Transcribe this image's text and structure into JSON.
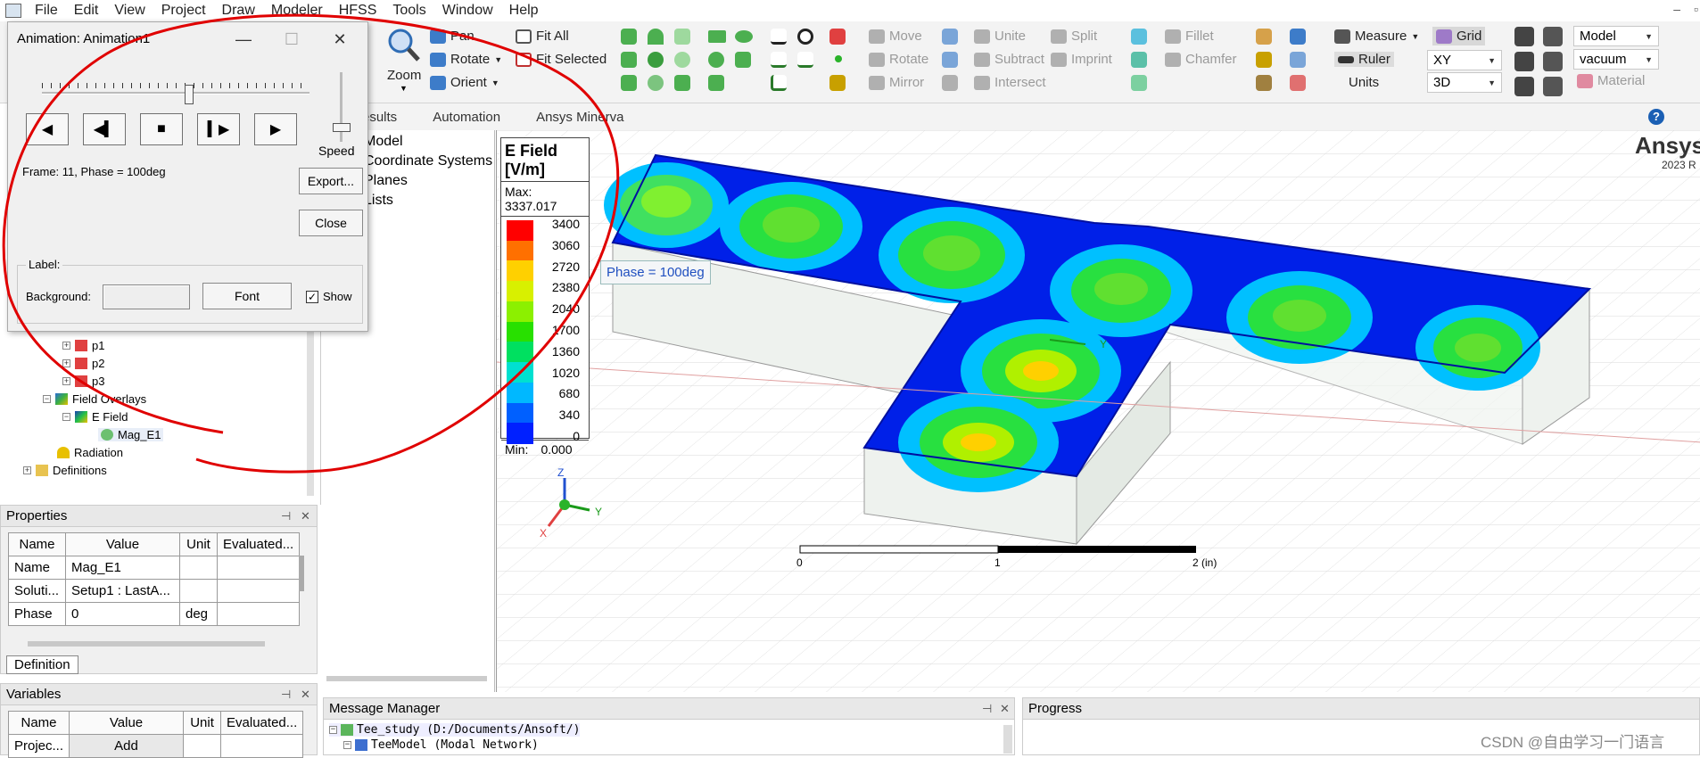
{
  "menu": [
    "File",
    "Edit",
    "View",
    "Project",
    "Draw",
    "Modeler",
    "HFSS",
    "Tools",
    "Window",
    "Help"
  ],
  "menu_underline": [
    "F",
    "E",
    "V",
    "P",
    "D",
    "M",
    "H",
    "T",
    "W",
    "H"
  ],
  "ribbon": {
    "zoom": "Zoom",
    "pan": "Pan",
    "rotate_view": "Rotate",
    "orient": "Orient",
    "fit_all": "Fit All",
    "fit_selected": "Fit Selected",
    "move": "Move",
    "rotate": "Rotate",
    "mirror": "Mirror",
    "unite": "Unite",
    "subtract": "Subtract",
    "intersect": "Intersect",
    "split": "Split",
    "imprint": "Imprint",
    "fillet": "Fillet",
    "chamfer": "Chamfer",
    "measure": "Measure",
    "ruler": "Ruler",
    "units": "Units",
    "grid": "Grid",
    "plane": "XY",
    "dim": "3D",
    "model": "Model",
    "material_value": "vacuum",
    "material": "Material"
  },
  "tabs": [
    "esults",
    "Automation",
    "Ansys Minerva"
  ],
  "help": "?",
  "tree_right": [
    "Model",
    "Coordinate Systems",
    "Planes",
    "Lists"
  ],
  "tree_left": [
    {
      "label": "p1"
    },
    {
      "label": "p2"
    },
    {
      "label": "p3"
    },
    {
      "label": "Field Overlays"
    },
    {
      "label": "E Field"
    },
    {
      "label": "Mag_E1"
    },
    {
      "label": "Radiation"
    },
    {
      "label": "Definitions"
    }
  ],
  "animation_dialog": {
    "title": "Animation: Animation1",
    "minimize": "—",
    "maximize": "☐",
    "close_x": "✕",
    "speed": "Speed",
    "frame_info": "Frame: 11, Phase = 100deg",
    "export": "Export...",
    "close": "Close",
    "label_group": "Label:",
    "background": "Background:",
    "font": "Font",
    "show": "Show",
    "show_checked": true,
    "slider_fraction": 0.55,
    "speed_fraction": 0.85
  },
  "properties": {
    "title": "Properties",
    "columns": [
      "Name",
      "Value",
      "Unit",
      "Evaluated..."
    ],
    "rows": [
      [
        "Name",
        "Mag_E1",
        "",
        ""
      ],
      [
        "Soluti...",
        "Setup1 : LastA...",
        "",
        ""
      ],
      [
        "Phase",
        "0",
        "deg",
        ""
      ]
    ],
    "tab": "Definition"
  },
  "variables": {
    "title": "Variables",
    "columns": [
      "Name",
      "Value",
      "Unit",
      "Evaluated..."
    ],
    "rows": [
      [
        "Projec...",
        "Add",
        "",
        ""
      ]
    ]
  },
  "legend": {
    "title_line1": "E Field",
    "title_line2": "[V/m]",
    "max": "Max: 3337.017",
    "min_label": "Min:",
    "min_value": "0.000",
    "ticks": [
      "3400",
      "3060",
      "2720",
      "2380",
      "2040",
      "1700",
      "1360",
      "1020",
      "680",
      "340",
      "0"
    ],
    "colors": [
      "#ff0000",
      "#ff7000",
      "#ffd000",
      "#d8f000",
      "#8cf000",
      "#28e000",
      "#00e060",
      "#00e0d0",
      "#00b8ff",
      "#0060ff",
      "#0020ff"
    ]
  },
  "viewport": {
    "phase_label": "Phase = 100deg",
    "brand": "Ansys",
    "version": "2023 R",
    "axis_x": "X",
    "axis_y": "Y",
    "axis_z": "Z",
    "scale_labels": [
      "0",
      "1",
      "2 (in)"
    ]
  },
  "message_manager": {
    "title": "Message Manager",
    "lines": [
      "Tee_study (D:/Documents/Ansoft/)",
      "TeeModel (Modal Network)"
    ]
  },
  "progress": {
    "title": "Progress"
  },
  "watermark": "CSDN @自由学习一门语言",
  "colors": {
    "annotation": "#e00000",
    "accent": "#1a5fb4"
  }
}
